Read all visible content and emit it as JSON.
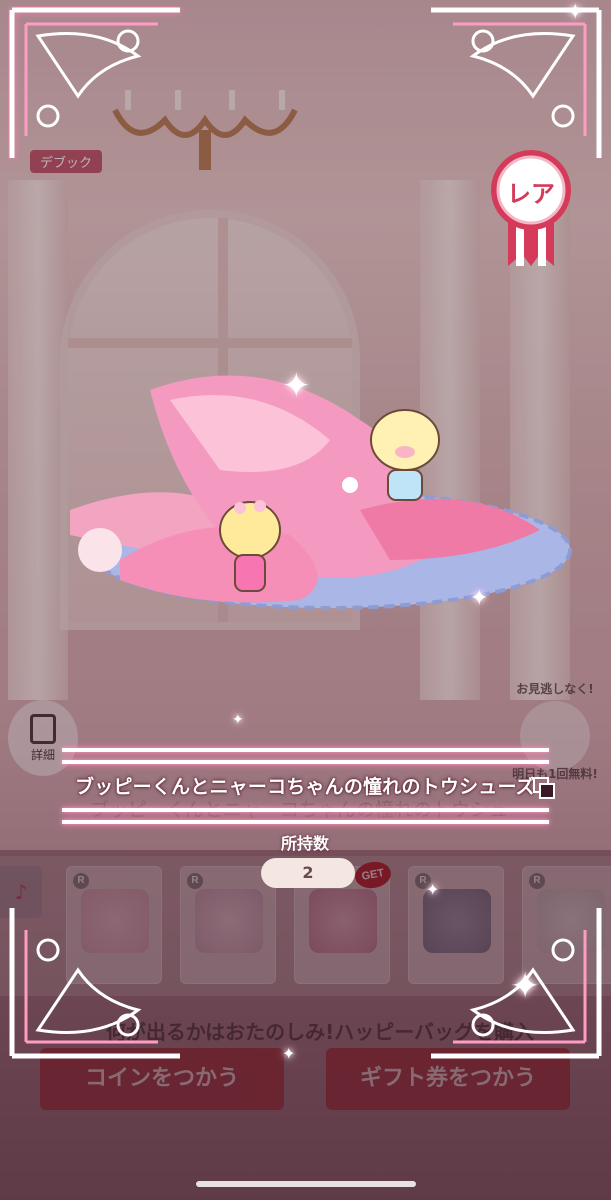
{
  "item": {
    "name": "ブッピーくんとニャーコちゃんの憧れのトウシューズ",
    "rarity_label": "レア",
    "owned_label": "所持数",
    "owned_count": "2"
  },
  "background": {
    "back_label": "デブック",
    "detail_label": "詳細",
    "free_top": "お見逃しなく!",
    "free_bottom": "明日も1回無料!",
    "ghost_title": "ブッピーくんとニャーコちゃんの憧れのトウシューズ",
    "get_badge": "GET",
    "card_badge": "R",
    "promo_text": "何が出るかはおたのしみ!ハッピーバッグを購入",
    "coin_button": "コインをつかう",
    "gift_button": "ギフト券をつかう"
  },
  "colors": {
    "frame_glow": "#ff7fb0",
    "rare_red": "#d53a5a",
    "button_red": "#a8343c"
  }
}
